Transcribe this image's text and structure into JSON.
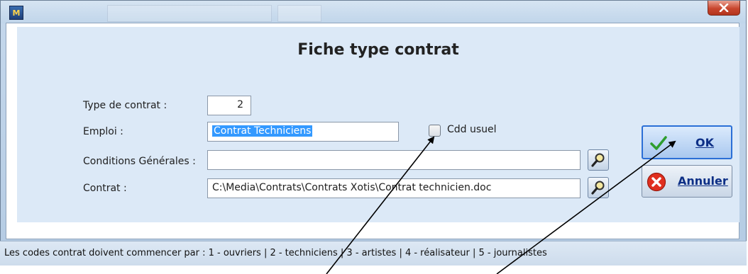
{
  "window": {
    "app_icon_text": "M",
    "close_icon": "close-x-icon"
  },
  "form": {
    "title": "Fiche type contrat",
    "type_contrat_label": "Type de contrat :",
    "type_contrat_value": "2",
    "emploi_label": "Emploi :",
    "emploi_value": "Contrat Techniciens",
    "cdd_label": "Cdd usuel",
    "cdd_checked": false,
    "conditions_label": "Conditions Générales :",
    "conditions_value": "",
    "contrat_label": "Contrat :",
    "contrat_value": "C:\\Media\\Contrats\\Contrats Xotis\\Contrat technicien.doc"
  },
  "buttons": {
    "ok_label": "OK",
    "cancel_label": "Annuler"
  },
  "status": {
    "text": "Les codes contrat doivent commencer par : 1 - ouvriers | 2 - techniciens | 3 - artistes | 4 - réalisateur | 5 - journalistes"
  },
  "colors": {
    "accent": "#2b6fd6",
    "selection": "#3399ff",
    "close": "#c8462e"
  }
}
